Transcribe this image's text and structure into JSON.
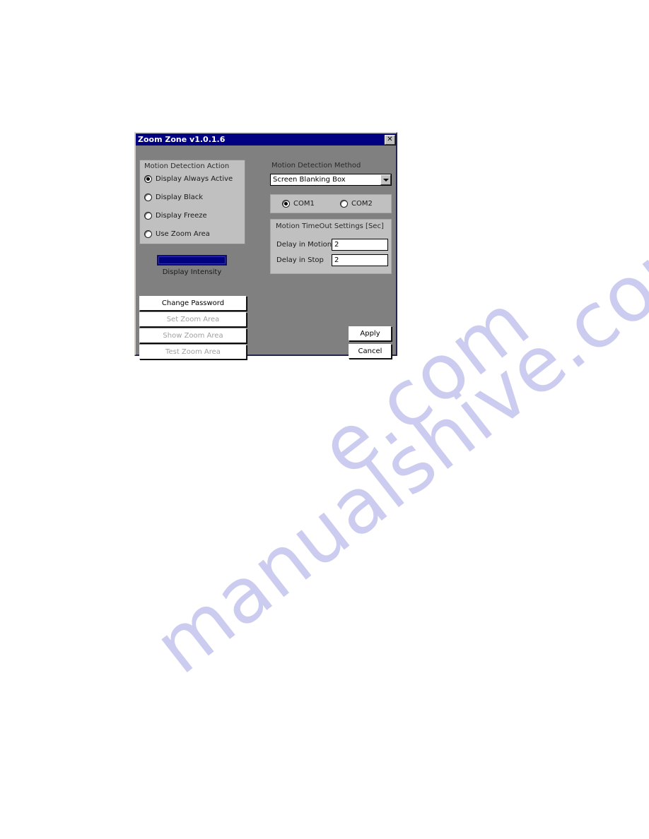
{
  "window": {
    "title": "Zoom Zone v1.0.1.6",
    "close_icon": "close-icon",
    "close_glyph": "✕",
    "titlebar_color": "#000080",
    "client_color": "#808080"
  },
  "action_group": {
    "title": "Motion Detection Action",
    "options": [
      {
        "label": "Display Always Active",
        "selected": true
      },
      {
        "label": "Display Black",
        "selected": false
      },
      {
        "label": "Display Freeze",
        "selected": false
      },
      {
        "label": "Use Zoom Area",
        "selected": false
      }
    ]
  },
  "intensity": {
    "label": "Display Intensity",
    "fill_color": "#000080",
    "value_percent": 100
  },
  "action_buttons": [
    {
      "label": "Change Password",
      "enabled": true
    },
    {
      "label": "Set Zoom Area",
      "enabled": false
    },
    {
      "label": "Show Zoom Area",
      "enabled": false
    },
    {
      "label": "Test Zoom Area",
      "enabled": false
    }
  ],
  "method": {
    "label": "Motion Detection Method",
    "selected": "Screen Blanking Box",
    "dropdown_icon": "chevron-down-icon"
  },
  "com_port": {
    "options": [
      {
        "label": "COM1",
        "selected": true
      },
      {
        "label": "COM2",
        "selected": false
      }
    ]
  },
  "timeout_group": {
    "title": "Motion TimeOut Settings [Sec]",
    "fields": [
      {
        "label": "Delay in Motion",
        "value": "2"
      },
      {
        "label": "Delay in Stop",
        "value": "2"
      }
    ]
  },
  "dialog_buttons": {
    "apply": "Apply",
    "cancel": "Cancel"
  },
  "watermark": {
    "text": "manualshive.com",
    "partial": "e.com",
    "color": "#ccccf0"
  }
}
